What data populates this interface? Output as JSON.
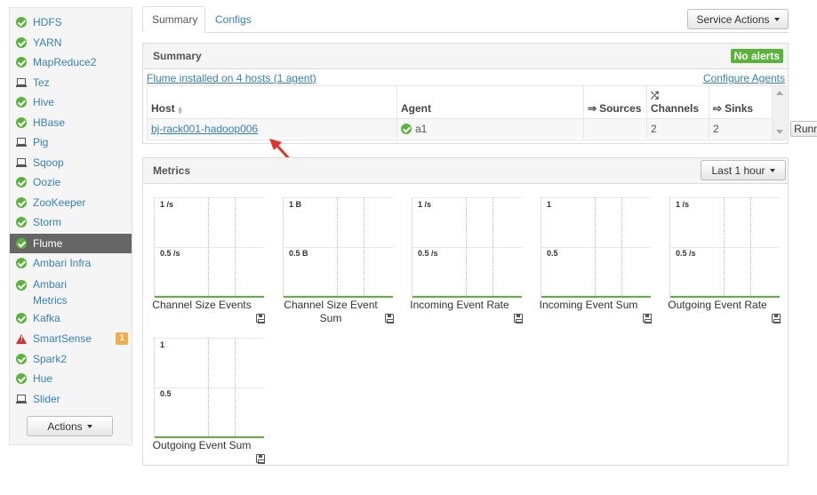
{
  "sidebar": {
    "items": [
      {
        "label": "HDFS",
        "icon": "check-circle-icon"
      },
      {
        "label": "YARN",
        "icon": "check-circle-icon"
      },
      {
        "label": "MapReduce2",
        "icon": "check-circle-icon"
      },
      {
        "label": "Tez",
        "icon": "laptop-icon"
      },
      {
        "label": "Hive",
        "icon": "check-circle-icon"
      },
      {
        "label": "HBase",
        "icon": "check-circle-icon"
      },
      {
        "label": "Pig",
        "icon": "laptop-icon"
      },
      {
        "label": "Sqoop",
        "icon": "laptop-icon"
      },
      {
        "label": "Oozie",
        "icon": "check-circle-icon"
      },
      {
        "label": "ZooKeeper",
        "icon": "check-circle-icon"
      },
      {
        "label": "Storm",
        "icon": "check-circle-icon"
      },
      {
        "label": "Flume",
        "icon": "check-circle-icon",
        "active": true
      },
      {
        "label": "Ambari Infra",
        "icon": "check-circle-icon"
      },
      {
        "label": "Ambari Metrics",
        "icon": "check-circle-icon"
      },
      {
        "label": "Kafka",
        "icon": "check-circle-icon"
      },
      {
        "label": "SmartSense",
        "icon": "warning-icon",
        "badge": "1"
      },
      {
        "label": "Spark2",
        "icon": "check-circle-icon"
      },
      {
        "label": "Hue",
        "icon": "check-circle-icon"
      },
      {
        "label": "Slider",
        "icon": "laptop-icon"
      }
    ],
    "actions_label": "Actions"
  },
  "tabs": [
    {
      "label": "Summary",
      "active": true
    },
    {
      "label": "Configs",
      "active": false
    }
  ],
  "service_actions_label": "Service Actions",
  "summary": {
    "title": "Summary",
    "alert_badge": "No alerts",
    "installed_link": "Flume installed on 4 hosts (1 agent)",
    "configure_link": "Configure Agents",
    "columns": {
      "host": "Host",
      "agent": "Agent",
      "sources": "Sources",
      "channels": "Channels",
      "sinks": "Sinks"
    },
    "row": {
      "host": "bj-rack001-hadoop006",
      "agent": "a1",
      "status": "Running",
      "sources": "",
      "channels": "2",
      "sinks": "2"
    }
  },
  "metrics": {
    "title": "Metrics",
    "time_range": "Last 1 hour",
    "widgets": [
      {
        "title": "Channel Size Events",
        "y_top": "1 /s",
        "y_mid": "0.5 /s"
      },
      {
        "title": "Channel Size Event Sum",
        "y_top": "1 B",
        "y_mid": "0.5 B"
      },
      {
        "title": "Incoming Event Rate",
        "y_top": "1 /s",
        "y_mid": "0.5 /s"
      },
      {
        "title": "Incoming Event Sum",
        "y_top": "1",
        "y_mid": "0.5"
      },
      {
        "title": "Outgoing Event Rate",
        "y_top": "1 /s",
        "y_mid": "0.5 /s"
      },
      {
        "title": "Outgoing Event Sum",
        "y_top": "1",
        "y_mid": "0.5"
      }
    ]
  },
  "colors": {
    "link": "#3681b8",
    "ok_green": "#5ab43a",
    "alert_red": "#d9312b",
    "badge_orange": "#f0ad4e",
    "active_item_bg": "#666666"
  }
}
